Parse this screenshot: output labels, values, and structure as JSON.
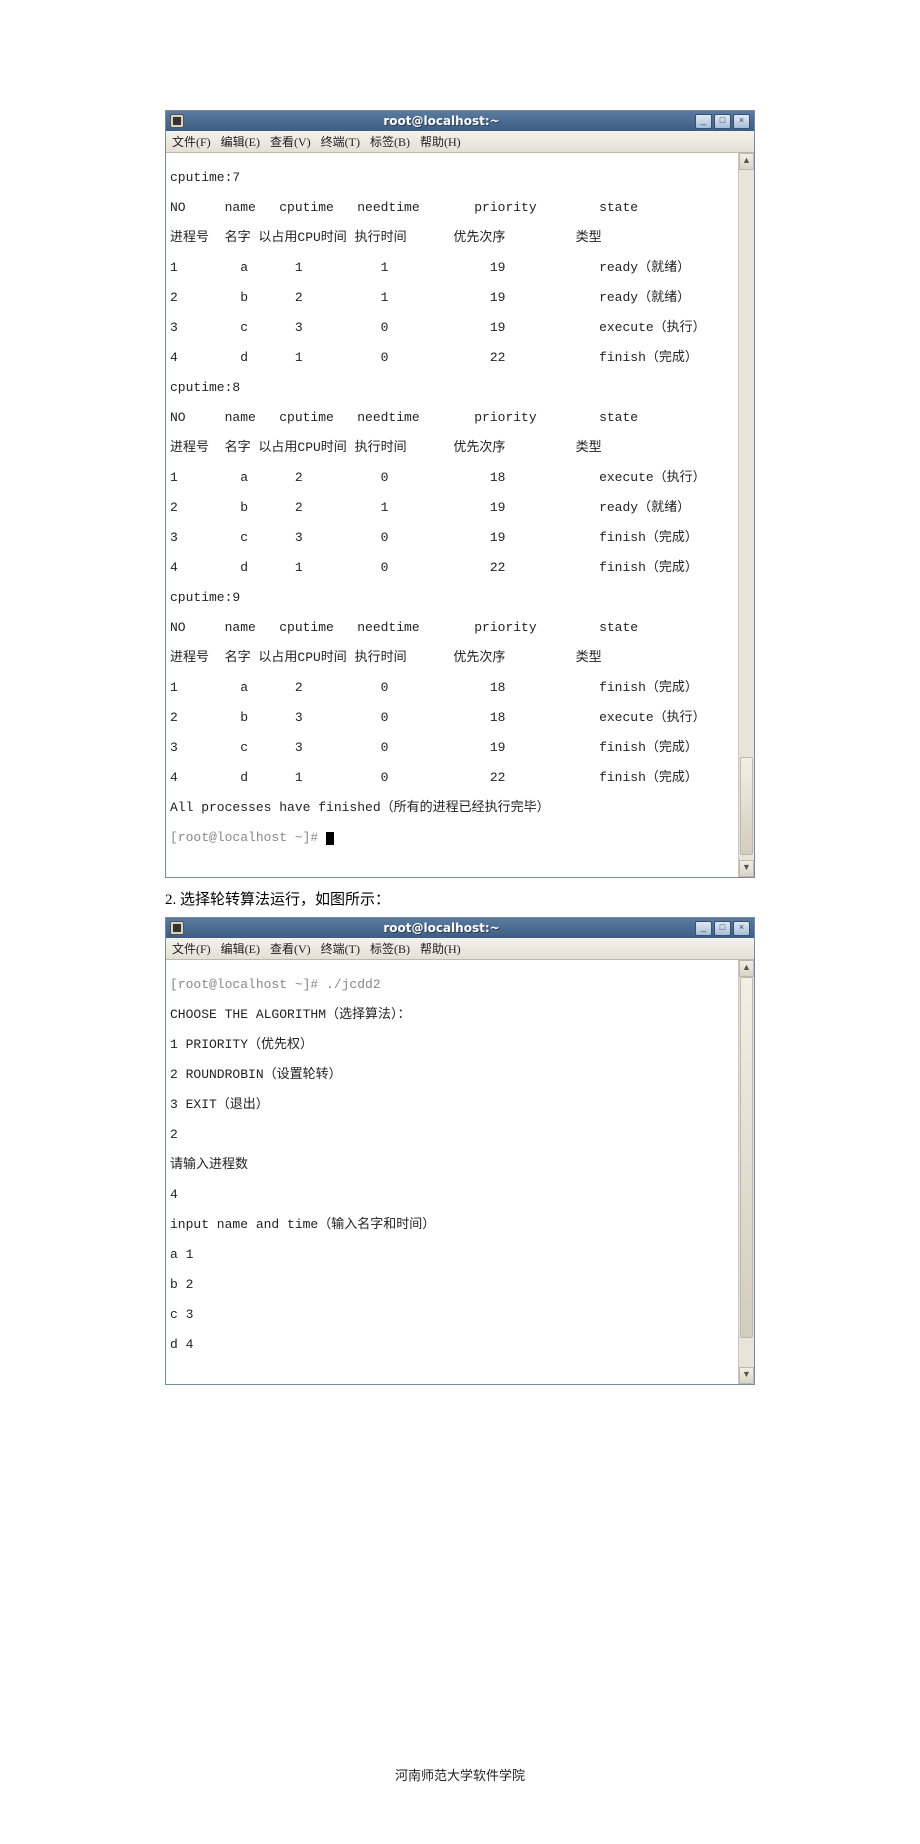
{
  "window1": {
    "title": "root@localhost:~",
    "menus": [
      "文件(F)",
      "编辑(E)",
      "查看(V)",
      "终端(T)",
      "标签(B)",
      "帮助(H)"
    ],
    "lines": [
      "cputime:7",
      "NO     name   cputime   needtime       priority        state",
      "进程号  名字 以占用CPU时间 执行时间      优先次序         类型",
      "1        a      1          1             19            ready（就绪）",
      "2        b      2          1             19            ready（就绪）",
      "3        c      3          0             19            execute（执行）",
      "4        d      1          0             22            finish（完成）",
      "cputime:8",
      "NO     name   cputime   needtime       priority        state",
      "进程号  名字 以占用CPU时间 执行时间      优先次序         类型",
      "1        a      2          0             18            execute（执行）",
      "2        b      2          1             19            ready（就绪）",
      "3        c      3          0             19            finish（完成）",
      "4        d      1          0             22            finish（完成）",
      "cputime:9",
      "NO     name   cputime   needtime       priority        state",
      "进程号  名字 以占用CPU时间 执行时间      优先次序         类型",
      "1        a      2          0             18            finish（完成）",
      "2        b      3          0             18            execute（执行）",
      "3        c      3          0             19            finish（完成）",
      "4        d      1          0             22            finish（完成）",
      "All processes have finished（所有的进程已经执行完毕）"
    ],
    "prompt": "[root@localhost ~]# "
  },
  "caption": "2. 选择轮转算法运行，如图所示：",
  "window2": {
    "title": "root@localhost:~",
    "menus": [
      "文件(F)",
      "编辑(E)",
      "查看(V)",
      "终端(T)",
      "标签(B)",
      "帮助(H)"
    ],
    "lines": [
      "[root@localhost ~]# ./jcdd2",
      "CHOOSE THE ALGORITHM（选择算法）：",
      "1 PRIORITY（优先权）",
      "2 ROUNDROBIN（设置轮转）",
      "3 EXIT（退出）",
      "2",
      "请输入进程数",
      "4",
      "input name and time（输入名字和时间）",
      "a 1",
      "b 2",
      "c 3",
      "d 4"
    ]
  },
  "footer": "河南师范大学软件学院",
  "chart_data": {
    "type": "table",
    "title": "Process scheduling snapshots (Priority algorithm)",
    "columns_en": [
      "NO",
      "name",
      "cputime",
      "needtime",
      "priority",
      "state"
    ],
    "columns_cn": [
      "进程号",
      "名字",
      "以占用CPU时间",
      "执行时间",
      "优先次序",
      "类型"
    ],
    "snapshots": [
      {
        "cputime": 7,
        "rows": [
          {
            "NO": 1,
            "name": "a",
            "cputime": 1,
            "needtime": 1,
            "priority": 19,
            "state": "ready（就绪）"
          },
          {
            "NO": 2,
            "name": "b",
            "cputime": 2,
            "needtime": 1,
            "priority": 19,
            "state": "ready（就绪）"
          },
          {
            "NO": 3,
            "name": "c",
            "cputime": 3,
            "needtime": 0,
            "priority": 19,
            "state": "execute（执行）"
          },
          {
            "NO": 4,
            "name": "d",
            "cputime": 1,
            "needtime": 0,
            "priority": 22,
            "state": "finish（完成）"
          }
        ]
      },
      {
        "cputime": 8,
        "rows": [
          {
            "NO": 1,
            "name": "a",
            "cputime": 2,
            "needtime": 0,
            "priority": 18,
            "state": "execute（执行）"
          },
          {
            "NO": 2,
            "name": "b",
            "cputime": 2,
            "needtime": 1,
            "priority": 19,
            "state": "ready（就绪）"
          },
          {
            "NO": 3,
            "name": "c",
            "cputime": 3,
            "needtime": 0,
            "priority": 19,
            "state": "finish（完成）"
          },
          {
            "NO": 4,
            "name": "d",
            "cputime": 1,
            "needtime": 0,
            "priority": 22,
            "state": "finish（完成）"
          }
        ]
      },
      {
        "cputime": 9,
        "rows": [
          {
            "NO": 1,
            "name": "a",
            "cputime": 2,
            "needtime": 0,
            "priority": 18,
            "state": "finish（完成）"
          },
          {
            "NO": 2,
            "name": "b",
            "cputime": 3,
            "needtime": 0,
            "priority": 18,
            "state": "execute（执行）"
          },
          {
            "NO": 3,
            "name": "c",
            "cputime": 3,
            "needtime": 0,
            "priority": 19,
            "state": "finish（完成）"
          },
          {
            "NO": 4,
            "name": "d",
            "cputime": 1,
            "needtime": 0,
            "priority": 22,
            "state": "finish（完成）"
          }
        ]
      }
    ],
    "final_message": "All processes have finished（所有的进程已经执行完毕）",
    "round_robin_input": {
      "command": "./jcdd2",
      "algorithm_choice": 2,
      "process_count": 4,
      "inputs": [
        {
          "name": "a",
          "time": 1
        },
        {
          "name": "b",
          "time": 2
        },
        {
          "name": "c",
          "time": 3
        },
        {
          "name": "d",
          "time": 4
        }
      ]
    }
  }
}
